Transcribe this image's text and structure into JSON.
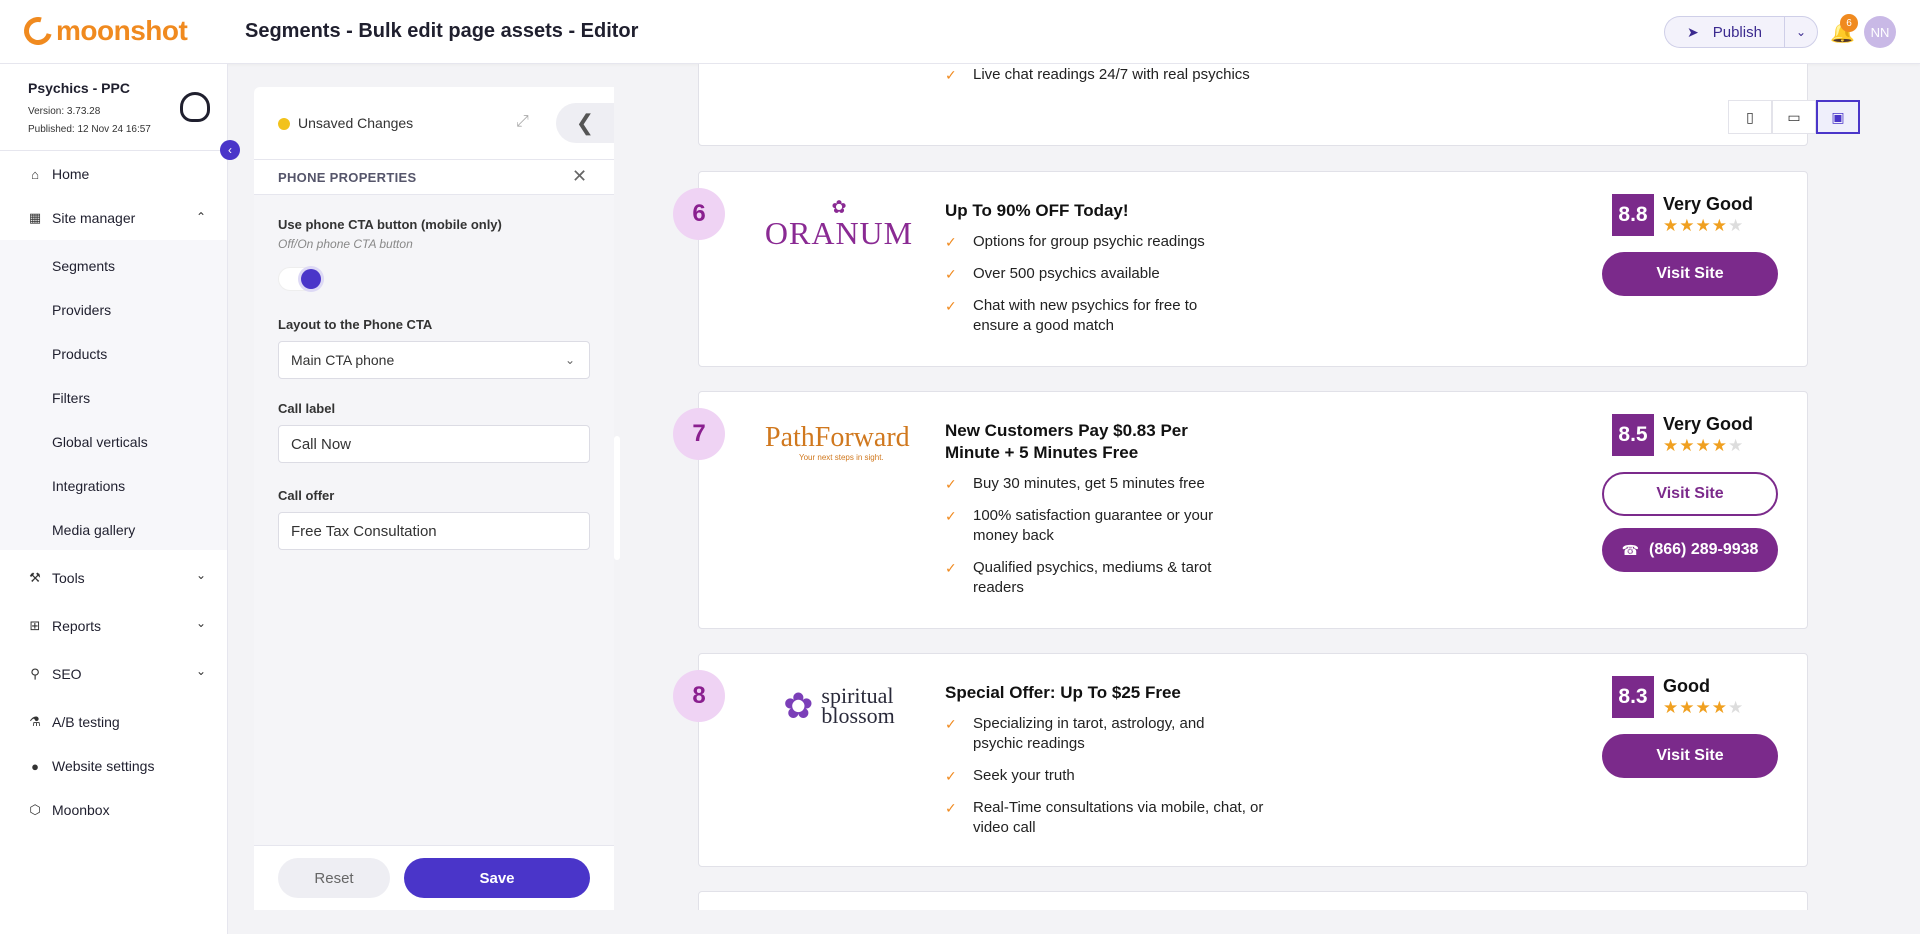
{
  "app": {
    "logo_text": "moonshot",
    "page_title": "Segments - Bulk edit page assets - Editor",
    "publish_label": "Publish",
    "notification_count": "6",
    "avatar_initials": "NN"
  },
  "site": {
    "name": "Psychics - PPC",
    "version": "Version: 3.73.28",
    "published": "Published: 12 Nov 24 16:57"
  },
  "sidebar": {
    "home": "Home",
    "site_manager": "Site manager",
    "sub_items": [
      "Segments",
      "Providers",
      "Products",
      "Filters",
      "Global verticals",
      "Integrations",
      "Media gallery"
    ],
    "tools": "Tools",
    "reports": "Reports",
    "seo": "SEO",
    "ab_testing": "A/B testing",
    "website_settings": "Website settings",
    "moonbox": "Moonbox"
  },
  "panel": {
    "unsaved": "Unsaved Changes",
    "header": "PHONE PROPERTIES",
    "use_phone_label": "Use phone CTA button (mobile only)",
    "use_phone_hint": "Off/On phone CTA button",
    "use_phone_on": true,
    "layout_label": "Layout to the Phone CTA",
    "layout_value": "Main CTA phone",
    "call_label_label": "Call label",
    "call_label_value": "Call Now",
    "call_offer_label": "Call offer",
    "call_offer_value": "Free Tax Consultation",
    "reset": "Reset",
    "save": "Save"
  },
  "preview": {
    "top_partial_feature": "Live chat readings 24/7 with real psychics",
    "cards": [
      {
        "rank": "6",
        "brand": "ORANUM",
        "headline": "Up To 90% OFF Today!",
        "features": [
          "Options for group psychic readings",
          "Over 500 psychics available",
          "Chat with new psychics for free to ensure a good match"
        ],
        "score": "8.8",
        "verdict": "Very Good",
        "stars": 4.5,
        "visit": "Visit Site"
      },
      {
        "rank": "7",
        "brand": "PathForward",
        "brand_tagline": "Your next steps in sight.",
        "headline": "New Customers Pay $0.83 Per Minute + 5 Minutes Free",
        "features": [
          "Buy 30 minutes, get 5 minutes free",
          "100% satisfaction guarantee or your money back",
          "Qualified psychics, mediums & tarot readers"
        ],
        "score": "8.5",
        "verdict": "Very Good",
        "stars": 4.5,
        "visit": "Visit Site",
        "phone": "(866) 289-9938"
      },
      {
        "rank": "8",
        "brand_line1": "spiritual",
        "brand_line2": "blossom",
        "headline": "Special Offer: Up To $25 Free",
        "features": [
          "Specializing in tarot, astrology, and psychic readings",
          "Seek your truth",
          "Real-Time consultations via mobile, chat, or video call"
        ],
        "score": "8.3",
        "verdict": "Good",
        "stars": 4,
        "visit": "Visit Site"
      }
    ]
  },
  "colors": {
    "accent": "#4a35c9",
    "brand_purple": "#7b2a8b",
    "orange": "#f08a1f",
    "unsaved_yellow": "#f2c21b"
  }
}
